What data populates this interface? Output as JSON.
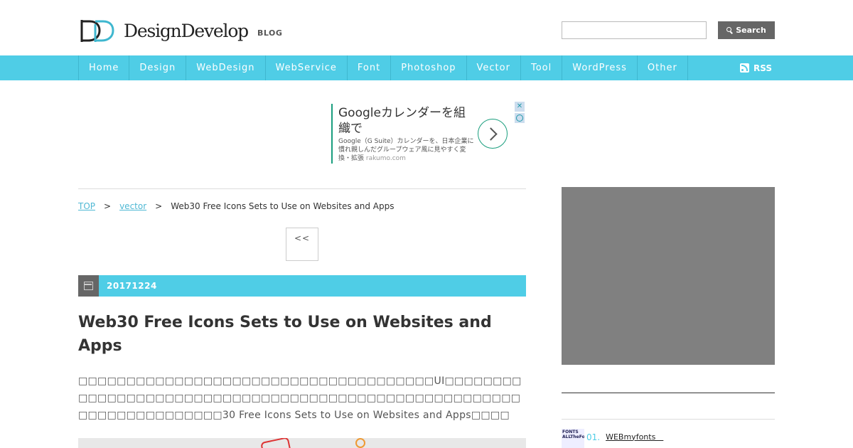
{
  "header": {
    "logo_text": "DesignDevelop",
    "logo_badge": "BLOG",
    "search_placeholder": "",
    "search_button": "Search"
  },
  "nav": {
    "items": [
      "Home",
      "Design",
      "WebDesign",
      "WebService",
      "Font",
      "Photoshop",
      "Vector",
      "Tool",
      "WordPress",
      "Other"
    ],
    "rss_label": "RSS"
  },
  "ad": {
    "headline": "Googleカレンダーを組織で",
    "description": "Google（G Suite）カレンダーを、日本企業に慣れ親しんだグループウェア風に見やすく変換・拡張",
    "domain": "rakumo.com",
    "close_glyph": "✕"
  },
  "breadcrumb": {
    "top": "TOP",
    "category": "vector",
    "current": "Web30 Free Icons Sets to Use on Websites and Apps",
    "separator": ">"
  },
  "pager": {
    "prev": "<<"
  },
  "post": {
    "date": "20171224",
    "title": "Web30 Free Icons Sets to Use on Websites and Apps",
    "excerpt": "□□□□□□□□□□□□□□□□□□□□□□□□□□□□□□□□□□□□□UI□□□□□□□□□□□□□□□□□□□□□□□□□□□□□□□□□□□□□□□□□□□□□□□□□□□□□□□□□□□□□□□□□□□□□30 Free Icons Sets to Use on Websites and Apps□□□□"
  },
  "sidebar": {
    "ranking": [
      {
        "rank": "01.",
        "title": "WEBmyfonts　",
        "thumb_text": "FONTS ALLTheFo"
      }
    ]
  }
}
